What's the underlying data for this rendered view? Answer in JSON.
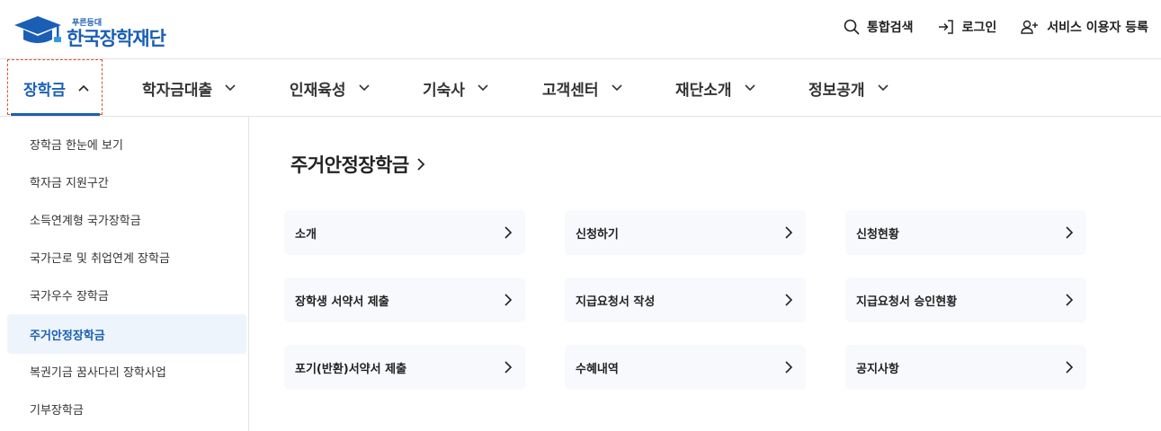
{
  "brand": {
    "small": "푸른등대",
    "name": "한국장학재단",
    "primary_color": "#1a5fb4"
  },
  "util": {
    "search": {
      "label": "통합검색",
      "icon": "search-icon"
    },
    "login": {
      "label": "로그인",
      "icon": "login-icon"
    },
    "register": {
      "label": "서비스 이용자 등록",
      "icon": "user-add-icon"
    }
  },
  "gnb": {
    "items": [
      {
        "label": "장학금",
        "expanded": true
      },
      {
        "label": "학자금대출",
        "expanded": false
      },
      {
        "label": "인재육성",
        "expanded": false
      },
      {
        "label": "기숙사",
        "expanded": false
      },
      {
        "label": "고객센터",
        "expanded": false
      },
      {
        "label": "재단소개",
        "expanded": false
      },
      {
        "label": "정보공개",
        "expanded": false
      }
    ]
  },
  "sidebar": {
    "items": [
      {
        "label": "장학금 한눈에 보기",
        "active": false
      },
      {
        "label": "학자금 지원구간",
        "active": false
      },
      {
        "label": "소득연계형 국가장학금",
        "active": false
      },
      {
        "label": "국가근로 및 취업연계 장학금",
        "active": false
      },
      {
        "label": "국가우수 장학금",
        "active": false
      },
      {
        "label": "주거안정장학금",
        "active": true
      },
      {
        "label": "복권기금 꿈사다리 장학사업",
        "active": false
      },
      {
        "label": "기부장학금",
        "active": false
      }
    ]
  },
  "main": {
    "title": "주거안정장학금",
    "cards": [
      {
        "label": "소개"
      },
      {
        "label": "신청하기"
      },
      {
        "label": "신청현황"
      },
      {
        "label": "장학생 서약서 제출"
      },
      {
        "label": "지급요청서 작성"
      },
      {
        "label": "지급요청서 승인현황"
      },
      {
        "label": "포기(반환)서약서 제출"
      },
      {
        "label": "수혜내역"
      },
      {
        "label": "공지사항"
      }
    ]
  }
}
